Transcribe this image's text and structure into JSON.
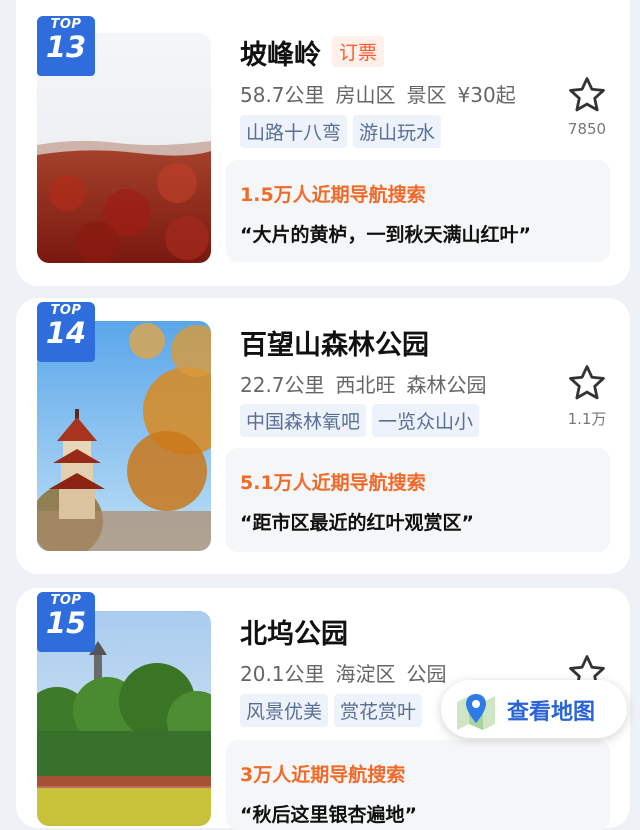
{
  "colors": {
    "badge_blue": "#2e6ddb",
    "hot_text": "#f06a2a",
    "booking_tag": "#ff5a2a",
    "chip_text": "#5a6f95",
    "map_link": "#2a63d6"
  },
  "items": [
    {
      "badge_top": "TOP",
      "rank": "13",
      "title": "坡峰岭",
      "booking": "订票",
      "distance": "58.7公里",
      "district": "房山区",
      "category": "景区",
      "price": "¥30起",
      "tags": [
        "山路十八弯",
        "游山玩水"
      ],
      "fav_count": "7850",
      "hot_text": "1.5万人近期导航搜索",
      "quote": "“大片的黄栌，一到秋天满山红叶”",
      "favorite_icon": "star-outline-icon"
    },
    {
      "badge_top": "TOP",
      "rank": "14",
      "title": "百望山森林公园",
      "distance": "22.7公里",
      "district": "西北旺",
      "category": "森林公园",
      "tags": [
        "中国森林氧吧",
        "一览众山小"
      ],
      "fav_count": "1.1万",
      "hot_text": "5.1万人近期导航搜索",
      "quote": "“距市区最近的红叶观赏区”",
      "favorite_icon": "star-outline-icon"
    },
    {
      "badge_top": "TOP",
      "rank": "15",
      "title": "北坞公园",
      "distance": "20.1公里",
      "district": "海淀区",
      "category": "公园",
      "tags": [
        "风景优美",
        "赏花赏叶"
      ],
      "hot_text": "3万人近期导航搜索",
      "quote": "“秋后这里银杏遍地”",
      "favorite_icon": "star-outline-icon"
    }
  ],
  "map_button": {
    "label": "查看地图",
    "icon": "map-pin-icon"
  }
}
